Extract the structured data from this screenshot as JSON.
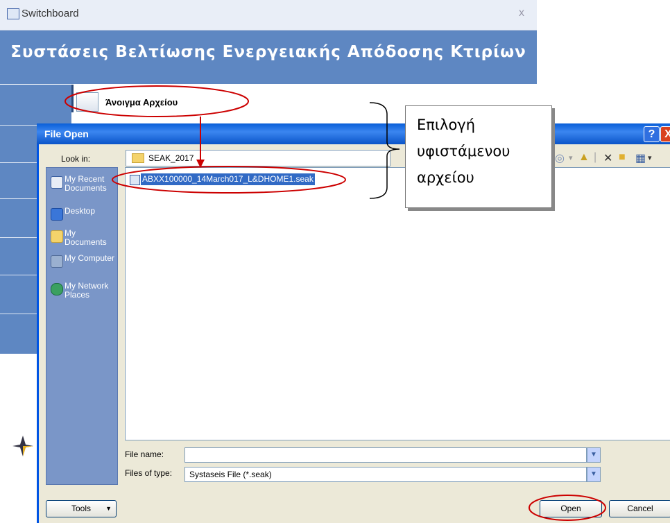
{
  "switchboard": {
    "title": "Switchboard",
    "close": "x",
    "header": "Συστάσεις Βελτίωσης Ενεργειακής Απόδοσης Κτιρίων",
    "open_file_label": "Άνοιγμα Αρχείου"
  },
  "dialog": {
    "title": "File Open",
    "help": "?",
    "close": "X",
    "look_in_label": "Look in:",
    "look_in_value": "SEAK_2017",
    "places": [
      {
        "label": "My Recent Documents",
        "icon": "recent-documents-icon"
      },
      {
        "label": "Desktop",
        "icon": "desktop-icon"
      },
      {
        "label": "My Documents",
        "icon": "my-documents-icon"
      },
      {
        "label": "My Computer",
        "icon": "my-computer-icon"
      },
      {
        "label": "My Network Places",
        "icon": "network-places-icon"
      }
    ],
    "file_item": "ABXX100000_14March017_L&DHOME1.seak",
    "file_name_label": "File name:",
    "file_name_value": "",
    "file_type_label": "Files of type:",
    "file_type_value": "Systaseis File (*.seak)",
    "tools_label": "Tools",
    "open_label": "Open",
    "cancel_label": "Cancel"
  },
  "callout": {
    "lines": [
      "Επιλογή",
      "υφιστάμενου",
      "αρχείου"
    ]
  },
  "colors": {
    "header_blue": "#5e87c2",
    "title_bar_blue": "#0a5fd8",
    "annotation_red": "#cc0000",
    "selection_blue": "#316ac5"
  }
}
